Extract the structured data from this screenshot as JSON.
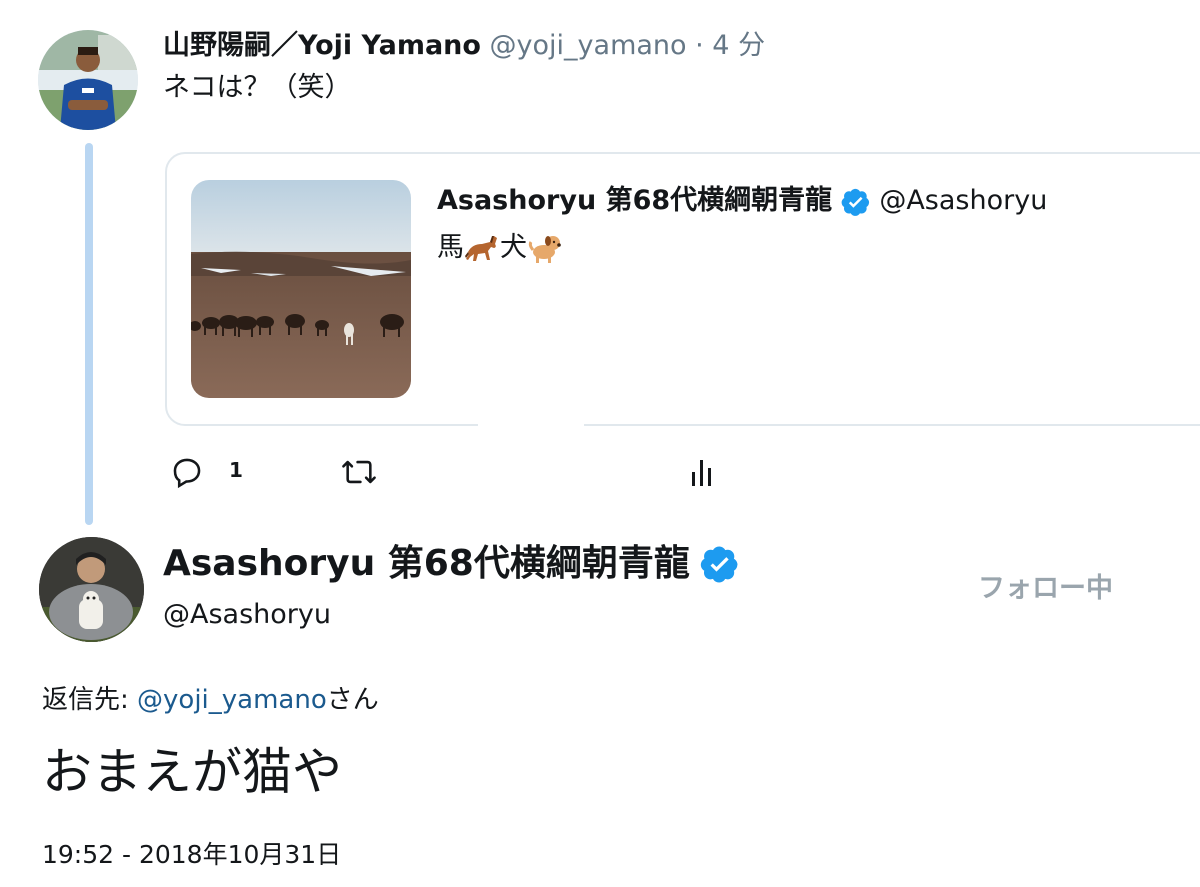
{
  "tweet1": {
    "display_name": "山野陽嗣／Yoji Yamano",
    "handle": "@yoji_yamano",
    "time": " · 4 分",
    "text": "ネコは？（笑）"
  },
  "quoted_tweet": {
    "display_name": "Asashoryu 第68代横綱朝青龍",
    "handle": "@Asashoryu",
    "text_part1": "馬",
    "text_part2": "犬",
    "emoji_1": "horse-emoji",
    "emoji_2": "dog-emoji"
  },
  "actions": {
    "reply_count": "1",
    "icons": [
      "reply-icon",
      "retweet-icon",
      "analytics-icon"
    ]
  },
  "tweet2": {
    "display_name": "Asashoryu 第68代横綱朝青龍",
    "handle": "@Asashoryu",
    "follow_label": "フォロー中",
    "reply_prefix": "返信先: ",
    "reply_mention": "@yoji_yamano",
    "reply_suffix": "さん",
    "text": "おまえが猫や",
    "timestamp": "19:52 - 2018年10月31日"
  },
  "colors": {
    "verified_blue": "#1d9bf0",
    "thread_line": "#b9d6f2",
    "mention_blue": "#1b5a8e",
    "follow_gray": "#9aa5ad"
  }
}
